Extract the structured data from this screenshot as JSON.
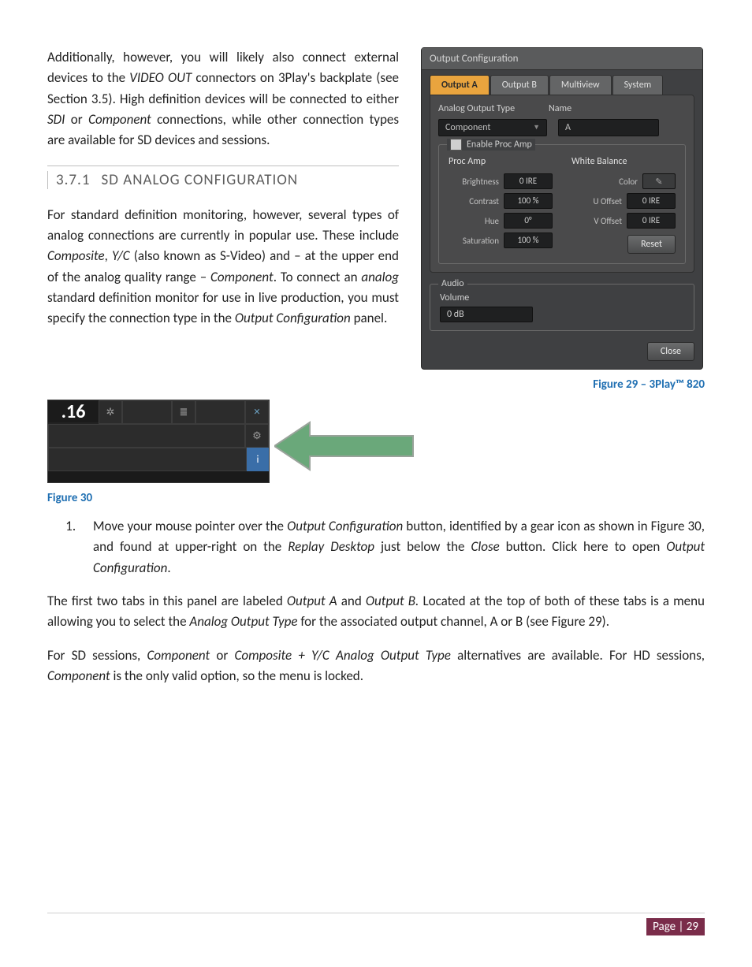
{
  "body": {
    "para1_a": "Additionally, however, you will likely also connect external devices to the ",
    "para1_b": "VIDEO OUT",
    "para1_c": " connectors on 3Play's backplate (see Section 3.5). High definition devices will be connected to either ",
    "para1_d": "SDI",
    "para1_e": " or ",
    "para1_f": "Component",
    "para1_g": " connections, while other connection types are available for SD devices and sessions.",
    "sec_num": "3.7.1",
    "sec_title": "SD ANALOG CONFIGURATION",
    "para2_a": "For standard definition monitoring, however, several types of analog connections are currently in popular use.  These include ",
    "para2_b": "Composite",
    "para2_c": ", ",
    "para2_d": "Y/C",
    "para2_e": " (also known as S-Video) and – at the upper end of the analog quality range – ",
    "para2_f": "Component",
    "para2_g": ".  To connect an ",
    "para2_h": "analog",
    "para2_i": " standard definition monitor for use in live production, you must specify the connection type in the ",
    "para2_j": "Output Configuration",
    "para2_k": " panel.",
    "fig30": "Figure 30",
    "list_a": "Move your mouse pointer over the ",
    "list_b": "Output Configuration",
    "list_c": " button, identified by a gear icon as shown in Figure 30, and found at upper-right on the ",
    "list_d": "Replay Desktop",
    "list_e": " just below the ",
    "list_f": "Close",
    "list_g": " button. Click here to open ",
    "list_h": "Output Configuration",
    "list_i": ".",
    "para3_a": "The first two tabs in this panel are labeled ",
    "para3_b": "Output A",
    "para3_c": " and ",
    "para3_d": "Output B.",
    "para3_e": " Located at the top of both of these tabs is a menu allowing you to select the ",
    "para3_f": "Analog Output Type",
    "para3_g": " for the associated output channel, A or B (see Figure 29).",
    "para4_a": "For SD sessions, ",
    "para4_b": "Component",
    "para4_c": " or ",
    "para4_d": "Composite + Y/C Analog Output Type",
    "para4_e": " alternatives are available. For HD sessions, ",
    "para4_f": "Component",
    "para4_g": " is the only valid option, so the menu is locked.",
    "page_label": "Page | 29"
  },
  "panel": {
    "title": "Output Configuration",
    "tabs": [
      "Output A",
      "Output B",
      "Multiview",
      "System"
    ],
    "analog_type_label": "Analog Output Type",
    "name_label": "Name",
    "analog_type_value": "Component",
    "name_value": "A",
    "enable_proc_amp": "Enable Proc Amp",
    "procamp_hd": "Proc Amp",
    "wb_hd": "White Balance",
    "brightness_k": "Brightness",
    "brightness_v": "0 IRE",
    "contrast_k": "Contrast",
    "contrast_v": "100 %",
    "hue_k": "Hue",
    "hue_v": "0°",
    "saturation_k": "Saturation",
    "saturation_v": "100 %",
    "color_k": "Color",
    "uoff_k": "U Offset",
    "uoff_v": "0 IRE",
    "voff_k": "V Offset",
    "voff_v": "0 IRE",
    "reset": "Reset",
    "audio_group": "Audio",
    "volume_label": "Volume",
    "volume_value": "0 dB",
    "close": "Close",
    "fig_caption": "Figure 29 – 3Play™ 820"
  },
  "mini": {
    "time": ".16"
  }
}
